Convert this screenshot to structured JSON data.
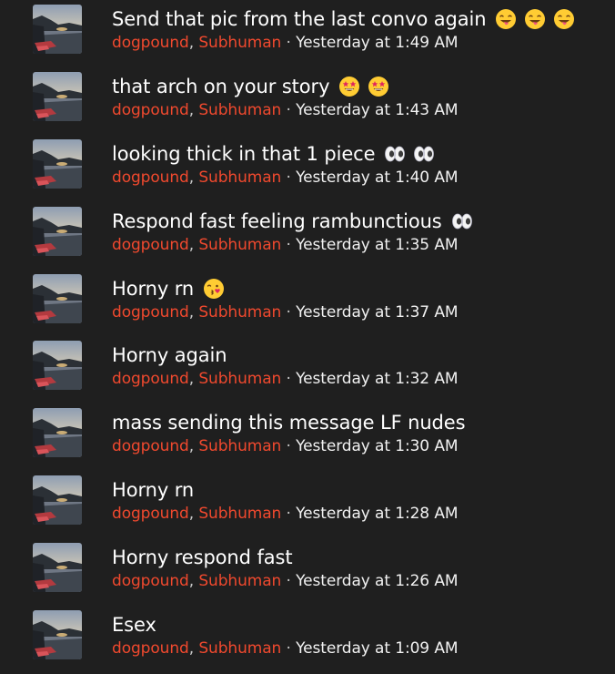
{
  "colors": {
    "background": "#1f1f1f",
    "name_accent": "#f0492e",
    "text": "#ffffff"
  },
  "messages": [
    {
      "text": "Send that pic from the last convo again",
      "emojis": [
        "tongue-wink-emoji",
        "tongue-wink-emoji",
        "tongue-wink-emoji"
      ],
      "sender1": "dogpound",
      "sender2": "Subhuman",
      "time": "Yesterday at 1:49 AM"
    },
    {
      "text": "that arch on your story",
      "emojis": [
        "star-struck-emoji",
        "star-struck-emoji"
      ],
      "sender1": "dogpound",
      "sender2": "Subhuman",
      "time": "Yesterday at 1:43 AM"
    },
    {
      "text": "looking thick in that 1 piece",
      "emojis": [
        "eyes-emoji",
        "eyes-emoji"
      ],
      "sender1": "dogpound",
      "sender2": "Subhuman",
      "time": "Yesterday at 1:40 AM"
    },
    {
      "text": "Respond fast feeling rambunctious",
      "emojis": [
        "eyes-emoji"
      ],
      "sender1": "dogpound",
      "sender2": "Subhuman",
      "time": "Yesterday at 1:35 AM"
    },
    {
      "text": "Horny rn",
      "emojis": [
        "kiss-emoji"
      ],
      "sender1": "dogpound",
      "sender2": "Subhuman",
      "time": "Yesterday at 1:37 AM"
    },
    {
      "text": "Horny again",
      "emojis": [],
      "sender1": "dogpound",
      "sender2": "Subhuman",
      "time": "Yesterday at 1:32 AM"
    },
    {
      "text": "mass sending this message LF nudes",
      "emojis": [],
      "sender1": "dogpound",
      "sender2": "Subhuman",
      "time": "Yesterday at 1:30 AM"
    },
    {
      "text": "Horny rn",
      "emojis": [],
      "sender1": "dogpound",
      "sender2": "Subhuman",
      "time": "Yesterday at 1:28 AM"
    },
    {
      "text": "Horny respond fast",
      "emojis": [],
      "sender1": "dogpound",
      "sender2": "Subhuman",
      "time": "Yesterday at 1:26 AM"
    },
    {
      "text": "Esex",
      "emojis": [],
      "sender1": "dogpound",
      "sender2": "Subhuman",
      "time": "Yesterday at 1:09 AM"
    }
  ],
  "separators": {
    "comma": ",",
    "dot": " · "
  }
}
